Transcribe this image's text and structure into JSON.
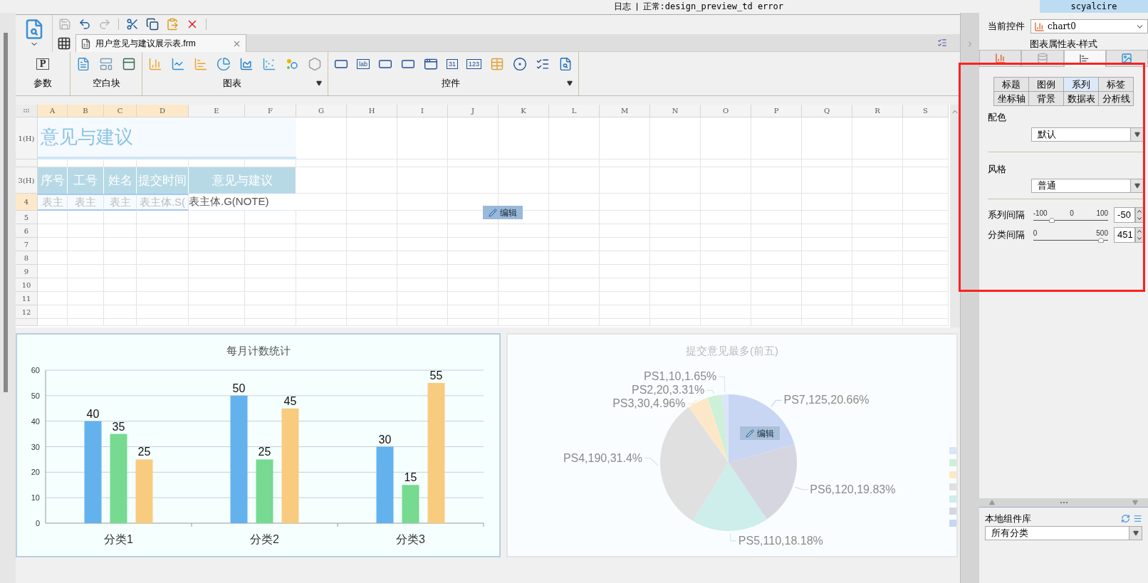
{
  "status_bar": {
    "log_button": "日志",
    "status": "正常:design_preview_td error",
    "user": "scyalcire"
  },
  "toolbar": {
    "buttons": [
      {
        "kind": "save",
        "disabled": true
      },
      {
        "kind": "undo",
        "disabled": false
      },
      {
        "kind": "redo",
        "disabled": true
      },
      {
        "kind": "cut",
        "disabled": false
      },
      {
        "kind": "copy",
        "disabled": false
      },
      {
        "kind": "paste",
        "disabled": false
      },
      {
        "kind": "delete",
        "disabled": false
      }
    ]
  },
  "document_tabs": [
    {
      "title": "用户意见与建议展示表.frm",
      "selected": true
    }
  ],
  "ribbon": {
    "groups": [
      {
        "label": "参数",
        "has_menu": false,
        "items": [
          {
            "kind": "param",
            "text": "P"
          }
        ]
      },
      {
        "label": "空白块",
        "has_menu": false,
        "items": [
          {
            "kind": "blank-report"
          },
          {
            "kind": "blank-absolute"
          },
          {
            "kind": "blank-tab"
          }
        ]
      },
      {
        "label": "图表",
        "has_menu": true,
        "items": [
          {
            "kind": "bar"
          },
          {
            "kind": "line"
          },
          {
            "kind": "hbar"
          },
          {
            "kind": "pie"
          },
          {
            "kind": "area"
          },
          {
            "kind": "scatter"
          },
          {
            "kind": "bubble"
          },
          {
            "kind": "radar"
          }
        ]
      },
      {
        "label": "控件",
        "has_menu": true,
        "items": [
          {
            "kind": "textfield"
          },
          {
            "kind": "label",
            "text": "lab"
          },
          {
            "kind": "button"
          },
          {
            "kind": "combo"
          },
          {
            "kind": "form"
          },
          {
            "kind": "date",
            "text": "31"
          },
          {
            "kind": "number",
            "text": "123"
          },
          {
            "kind": "table"
          },
          {
            "kind": "radio"
          },
          {
            "kind": "checkbox"
          },
          {
            "kind": "search"
          }
        ]
      }
    ]
  },
  "sheet": {
    "columns": [
      {
        "label": "A",
        "selected": true
      },
      {
        "label": "B",
        "selected": true
      },
      {
        "label": "C",
        "selected": true
      },
      {
        "label": "D",
        "selected": true
      },
      {
        "label": "E",
        "selected": false
      },
      {
        "label": "F",
        "selected": false
      },
      {
        "label": "G",
        "selected": false
      },
      {
        "label": "H",
        "selected": false
      },
      {
        "label": "I",
        "selected": false
      },
      {
        "label": "J",
        "selected": false
      },
      {
        "label": "K",
        "selected": false
      },
      {
        "label": "L",
        "selected": false
      },
      {
        "label": "M",
        "selected": false
      },
      {
        "label": "N",
        "selected": false
      },
      {
        "label": "O",
        "selected": false
      },
      {
        "label": "P",
        "selected": false
      },
      {
        "label": "Q",
        "selected": false
      },
      {
        "label": "R",
        "selected": false
      },
      {
        "label": "S",
        "selected": false
      }
    ],
    "rows": [
      {
        "label": "1(H)",
        "selected": false
      },
      {
        "selected": false
      },
      {
        "label": "3(H)",
        "selected": false
      },
      {
        "label": "4",
        "selected": true
      },
      {
        "label": "5",
        "selected": false
      },
      {
        "label": "6",
        "selected": false
      },
      {
        "label": "7",
        "selected": false
      },
      {
        "label": "8",
        "selected": false
      },
      {
        "label": "9",
        "selected": false
      },
      {
        "label": "10",
        "selected": false
      },
      {
        "label": "11",
        "selected": false
      },
      {
        "label": "12",
        "selected": false
      },
      {
        "selected": false
      }
    ],
    "title_cell": "意见与建议",
    "header_cells": [
      "序号",
      "工号",
      "姓名",
      "提交时间",
      "意见与建议"
    ],
    "data_cells": [
      {
        "text": "表主",
        "selected": true
      },
      {
        "text": "表主",
        "selected": true
      },
      {
        "text": "表主",
        "selected": true
      },
      {
        "text": "表主体.S(",
        "selected": true
      },
      {
        "text": "表主体.G(NOTE)",
        "selected": false
      }
    ],
    "edit_button": "编辑"
  },
  "charts": [
    {
      "title": "每月计数统计",
      "chart_data": {
        "type": "bar",
        "categories": [
          "分类1",
          "分类2",
          "分类3"
        ],
        "series": [
          {
            "color": "#63b2ee",
            "values": [
              40,
              50,
              30
            ]
          },
          {
            "color": "#76da91",
            "values": [
              35,
              25,
              15
            ]
          },
          {
            "color": "#f8cb7f",
            "values": [
              25,
              45,
              55
            ]
          }
        ],
        "ylim": [
          0,
          60
        ],
        "yticks": [
          0,
          10,
          20,
          30,
          40,
          50,
          60
        ],
        "grid": true,
        "data_labels": true
      }
    },
    {
      "title": "提交意见最多(前五)",
      "edit_button": "编辑",
      "chart_data": {
        "type": "pie",
        "values": [
          1.65,
          3.31,
          4.96,
          31.4,
          18.18,
          19.83,
          20.66
        ],
        "colors": [
          "#dae5f7",
          "#cdf0d8",
          "#fce8c8",
          "#e0e0e0",
          "#cdeeea",
          "#d6d6e0",
          "#c8d6f4"
        ],
        "value_labels": [
          "PS1,10,1.65%",
          "PS2,20,3.31%",
          "PS3,30,4.96%",
          "PS4,190,31.4%",
          "PS5,110,18.18%",
          "PS6,120,19.83%",
          "PS7,125,20.66%"
        ]
      }
    }
  ],
  "right_panel": {
    "current_control_label": "当前控件",
    "current_control": "chart0",
    "title": "图表属性表-样式",
    "icon_tabs": [
      {
        "kind": "type",
        "selected": false
      },
      {
        "kind": "data",
        "selected": false
      },
      {
        "kind": "style",
        "selected": true
      },
      {
        "kind": "effect",
        "selected": false
      }
    ],
    "sub_tabs": [
      {
        "label": "标题",
        "selected": false
      },
      {
        "label": "图例",
        "selected": false
      },
      {
        "label": "系列",
        "selected": true
      },
      {
        "label": "标签",
        "selected": false
      },
      {
        "label": "坐标轴",
        "selected": false
      },
      {
        "label": "背景",
        "selected": false
      },
      {
        "label": "数据表",
        "selected": false
      },
      {
        "label": "分析线",
        "selected": false
      }
    ],
    "color_scheme": {
      "label": "配色",
      "value": "默认"
    },
    "style": {
      "label": "风格",
      "value": "普通"
    },
    "sliders": [
      {
        "label": "系列间隔",
        "ticks": [
          "-100",
          "0",
          "100"
        ],
        "level": 0.25,
        "value": "-50"
      },
      {
        "label": "分类间隔",
        "ticks": [
          "0",
          "500"
        ],
        "level": 0.902,
        "value": "451"
      }
    ]
  },
  "component_library": {
    "title": "本地组件库",
    "filter": "所有分类"
  }
}
